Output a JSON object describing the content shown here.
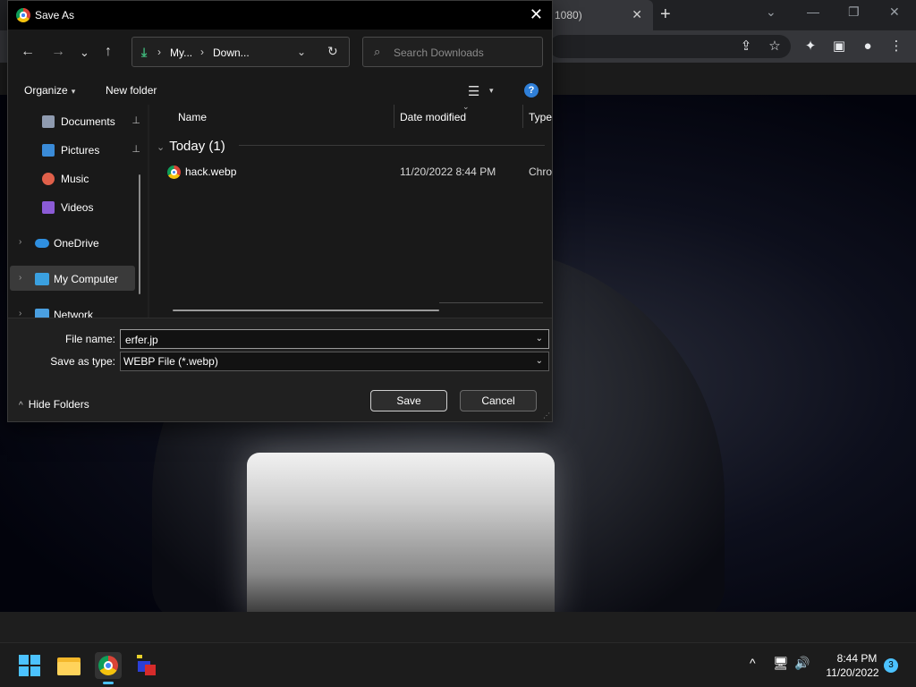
{
  "browser": {
    "tab_title": "1080)",
    "tab_close": "✕",
    "new_tab": "+",
    "minimize": "—",
    "maximize": "❐",
    "close": "✕",
    "chevron_down": "⌄"
  },
  "dialog": {
    "title": "Save As",
    "close": "✕",
    "nav": {
      "back": "←",
      "forward": "→",
      "recent": "⌄",
      "up": "↑"
    },
    "address": {
      "crumbs": [
        "My...",
        "Down..."
      ],
      "separator": "›",
      "dropdown": "⌄",
      "refresh": "↻"
    },
    "search": {
      "placeholder": "Search Downloads",
      "icon": "⌕"
    },
    "commands": {
      "organize": "Organize",
      "organize_dd": "▾",
      "new_folder": "New folder",
      "view_icon": "☰",
      "view_dd": "▾",
      "help": "?"
    },
    "nav_pane": {
      "items": [
        {
          "label": "Documents",
          "icon": "documents-icon",
          "pinned": true,
          "color": "#8f9bb0"
        },
        {
          "label": "Pictures",
          "icon": "pictures-icon",
          "pinned": true,
          "color": "#3a8bd8"
        },
        {
          "label": "Music",
          "icon": "music-icon",
          "pinned": false,
          "color": "#e0604a"
        },
        {
          "label": "Videos",
          "icon": "videos-icon",
          "pinned": false,
          "color": "#8b5bd6"
        },
        {
          "label": "OneDrive",
          "icon": "onedrive-icon",
          "expandable": true,
          "color": "#2f8fe0"
        },
        {
          "label": "My Computer",
          "icon": "computer-icon",
          "expandable": true,
          "selected": true,
          "color": "#3aa0e0"
        },
        {
          "label": "Network",
          "icon": "network-icon",
          "expandable": true,
          "color": "#4a9fe0"
        }
      ],
      "pin_glyph": "📌",
      "expand_glyph": "›"
    },
    "columns": {
      "name": "Name",
      "date_modified": "Date modified",
      "type": "Type",
      "sort_caret": "⌄"
    },
    "group": {
      "label": "Today (1)",
      "chevron": "⌄"
    },
    "files": [
      {
        "name": "hack.webp",
        "date": "11/20/2022 8:44 PM",
        "type": "Chro"
      }
    ],
    "file_name_label": "File name:",
    "file_name_value": "erfer.jp",
    "save_type_label": "Save as type:",
    "save_type_value": "WEBP File (*.webp)",
    "field_chevron": "⌄",
    "hide_folders": "Hide Folders",
    "hide_chev": "^",
    "save_button": "Save",
    "cancel_button": "Cancel",
    "grip": "⋰"
  },
  "taskbar": {
    "time": "8:44 PM",
    "date": "11/20/2022",
    "notifications": "3",
    "tray_up": "^",
    "network_icon": "🖥",
    "volume_icon": "🔊"
  }
}
